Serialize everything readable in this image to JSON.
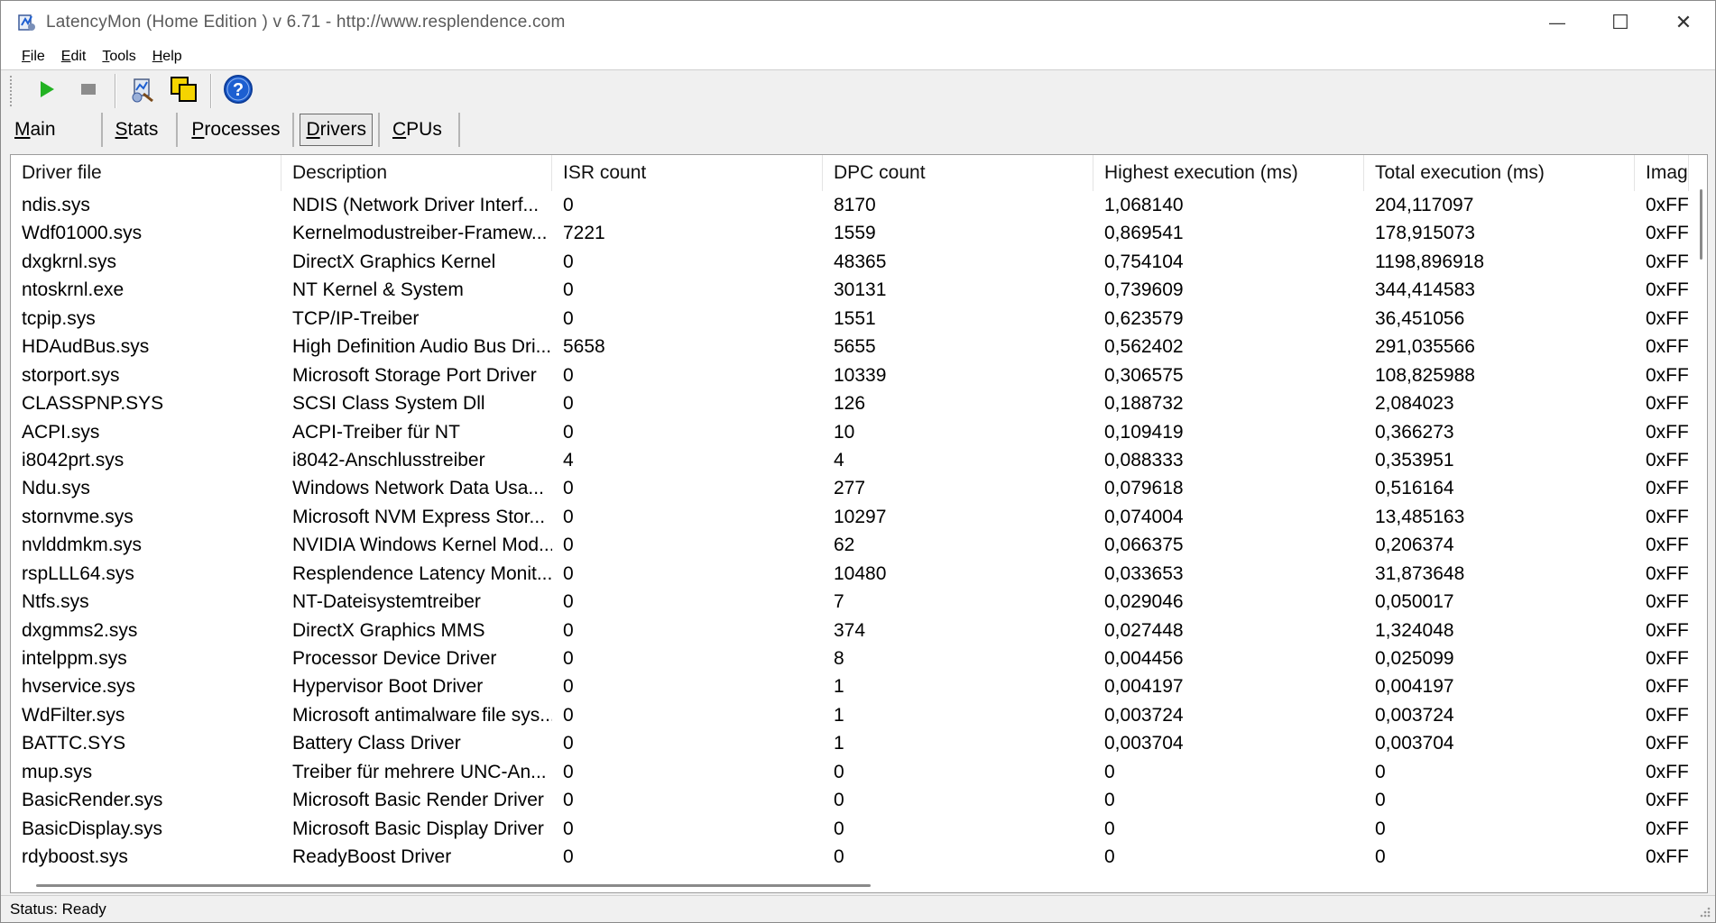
{
  "window": {
    "title": "LatencyMon  (Home Edition )  v 6.71 - http://www.resplendence.com",
    "minimize_label": "—",
    "maximize_label": "☐",
    "close_label": "✕"
  },
  "menu": {
    "items": [
      {
        "key": "F",
        "rest": "ile"
      },
      {
        "key": "E",
        "rest": "dit"
      },
      {
        "key": "T",
        "rest": "ools"
      },
      {
        "key": "H",
        "rest": "elp"
      }
    ]
  },
  "toolbar": {
    "icons": [
      "start-icon",
      "stop-icon",
      "analyze-icon",
      "copy-icon",
      "help-icon"
    ],
    "colors": {
      "start": "#22b222",
      "stop": "#8c8c8c",
      "help": "#1d5fd1"
    }
  },
  "tabs": [
    {
      "key": "M",
      "rest": "ain"
    },
    {
      "key": "S",
      "rest": "tats"
    },
    {
      "key": "P",
      "rest": "rocesses"
    },
    {
      "key": "D",
      "rest": "rivers"
    },
    {
      "key": "C",
      "rest": "PUs"
    }
  ],
  "active_tab": "Drivers",
  "table": {
    "columns": [
      "Driver file",
      "Description",
      "ISR count",
      "DPC count",
      "Highest execution (ms)",
      "Total execution (ms)",
      "Imag"
    ],
    "rows": [
      [
        "ndis.sys",
        "NDIS (Network Driver Interf...",
        "0",
        "8170",
        "1,068140",
        "204,117097",
        "0xFF"
      ],
      [
        "Wdf01000.sys",
        "Kernelmodustreiber-Framew...",
        "7221",
        "1559",
        "0,869541",
        "178,915073",
        "0xFF"
      ],
      [
        "dxgkrnl.sys",
        "DirectX Graphics Kernel",
        "0",
        "48365",
        "0,754104",
        "1198,896918",
        "0xFF"
      ],
      [
        "ntoskrnl.exe",
        "NT Kernel & System",
        "0",
        "30131",
        "0,739609",
        "344,414583",
        "0xFF"
      ],
      [
        "tcpip.sys",
        "TCP/IP-Treiber",
        "0",
        "1551",
        "0,623579",
        "36,451056",
        "0xFF"
      ],
      [
        "HDAudBus.sys",
        "High Definition Audio Bus Dri...",
        "5658",
        "5655",
        "0,562402",
        "291,035566",
        "0xFF"
      ],
      [
        "storport.sys",
        "Microsoft Storage Port Driver",
        "0",
        "10339",
        "0,306575",
        "108,825988",
        "0xFF"
      ],
      [
        "CLASSPNP.SYS",
        "SCSI Class System Dll",
        "0",
        "126",
        "0,188732",
        "2,084023",
        "0xFF"
      ],
      [
        "ACPI.sys",
        "ACPI-Treiber für NT",
        "0",
        "10",
        "0,109419",
        "0,366273",
        "0xFF"
      ],
      [
        "i8042prt.sys",
        "i8042-Anschlusstreiber",
        "4",
        "4",
        "0,088333",
        "0,353951",
        "0xFF"
      ],
      [
        "Ndu.sys",
        "Windows Network Data Usa...",
        "0",
        "277",
        "0,079618",
        "0,516164",
        "0xFF"
      ],
      [
        "stornvme.sys",
        "Microsoft NVM Express Stor...",
        "0",
        "10297",
        "0,074004",
        "13,485163",
        "0xFF"
      ],
      [
        "nvlddmkm.sys",
        "NVIDIA Windows Kernel Mod...",
        "0",
        "62",
        "0,066375",
        "0,206374",
        "0xFF"
      ],
      [
        "rspLLL64.sys",
        "Resplendence Latency Monit...",
        "0",
        "10480",
        "0,033653",
        "31,873648",
        "0xFF"
      ],
      [
        "Ntfs.sys",
        "NT-Dateisystemtreiber",
        "0",
        "7",
        "0,029046",
        "0,050017",
        "0xFF"
      ],
      [
        "dxgmms2.sys",
        "DirectX Graphics MMS",
        "0",
        "374",
        "0,027448",
        "1,324048",
        "0xFF"
      ],
      [
        "intelppm.sys",
        "Processor Device Driver",
        "0",
        "8",
        "0,004456",
        "0,025099",
        "0xFF"
      ],
      [
        "hvservice.sys",
        "Hypervisor Boot Driver",
        "0",
        "1",
        "0,004197",
        "0,004197",
        "0xFF"
      ],
      [
        "WdFilter.sys",
        "Microsoft antimalware file sys...",
        "0",
        "1",
        "0,003724",
        "0,003724",
        "0xFF"
      ],
      [
        "BATTC.SYS",
        "Battery Class Driver",
        "0",
        "1",
        "0,003704",
        "0,003704",
        "0xFF"
      ],
      [
        "mup.sys",
        "Treiber für mehrere UNC-An...",
        "0",
        "0",
        "0",
        "0",
        "0xFF"
      ],
      [
        "BasicRender.sys",
        "Microsoft Basic Render Driver",
        "0",
        "0",
        "0",
        "0",
        "0xFF"
      ],
      [
        "BasicDisplay.sys",
        "Microsoft Basic Display Driver",
        "0",
        "0",
        "0",
        "0",
        "0xFF"
      ],
      [
        "rdyboost.sys",
        "ReadyBoost Driver",
        "0",
        "0",
        "0",
        "0",
        "0xFF"
      ]
    ]
  },
  "status": {
    "text": "Status: Ready"
  }
}
